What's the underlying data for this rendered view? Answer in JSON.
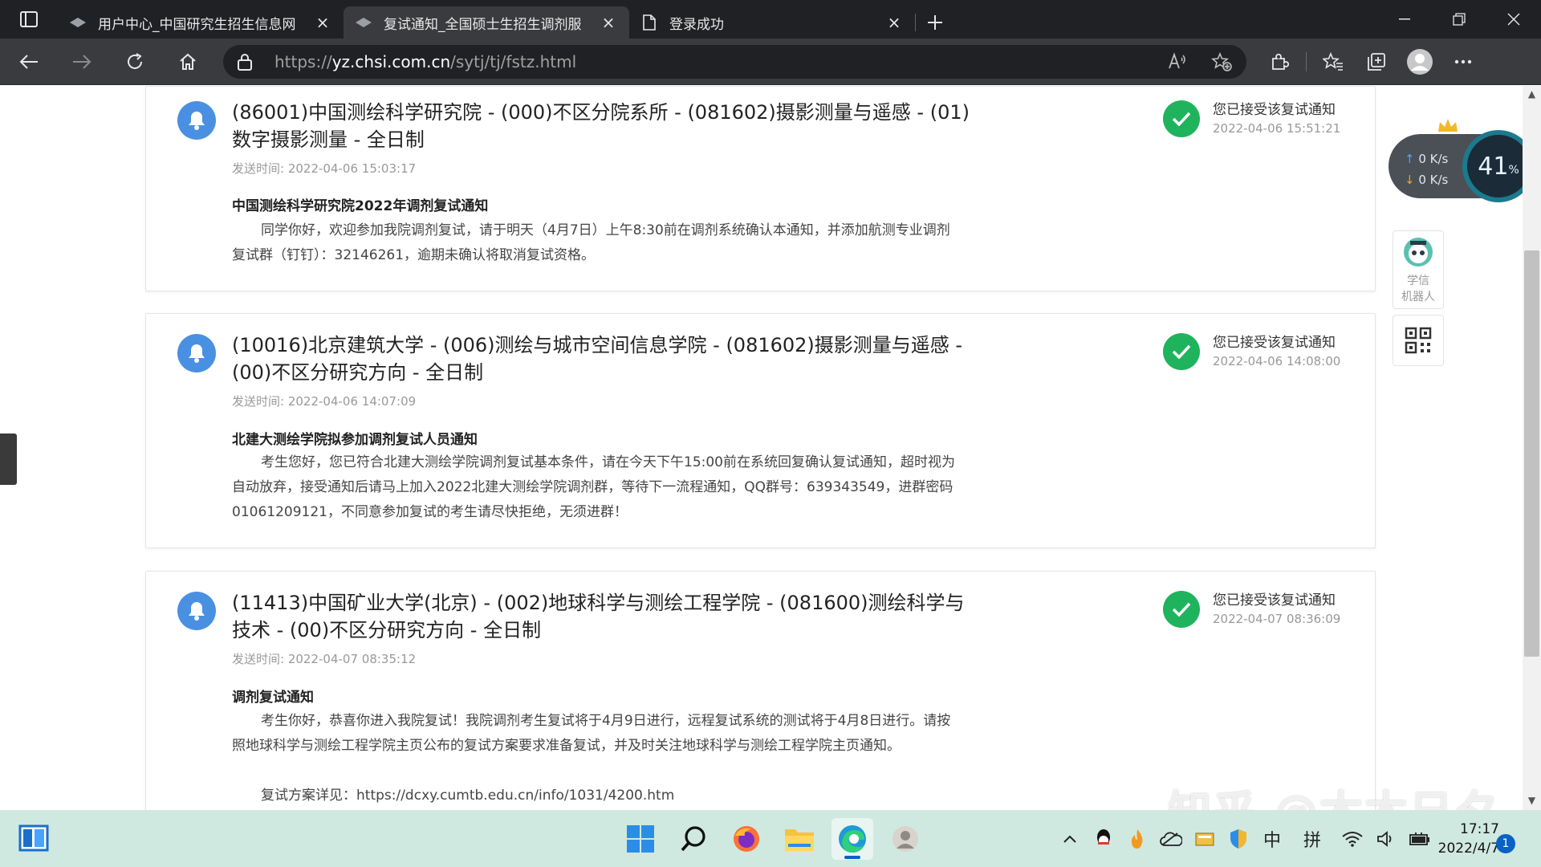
{
  "browser": {
    "tabs": [
      {
        "title": "用户中心_中国研究生招生信息网",
        "active": false
      },
      {
        "title": "复试通知_全国硕士生招生调剂服",
        "active": true
      },
      {
        "title": "登录成功",
        "active": false
      }
    ],
    "close_glyph": "×",
    "new_tab_glyph": "+",
    "url_prefix": "https://",
    "url_domain": "yz.chsi.com.cn",
    "url_path": "/sytj/tj/fstz.html"
  },
  "notices": [
    {
      "title": "(86001)中国测绘科学研究院 - (000)不区分院系所 - (081602)摄影测量与遥感 - (01)数字摄影测量 - 全日制",
      "sent_label": "发送时间:",
      "sent_time": "2022-04-06 15:03:17",
      "subject": "中国测绘科学研究院2022年调剂复试通知",
      "body": "同学你好，欢迎参加我院调剂复试，请于明天（4月7日）上午8:30前在调剂系统确认本通知，并添加航测专业调剂复试群（钉钉）：32146261，逾期未确认将取消复试资格。",
      "status": "您已接受该复试通知",
      "status_time": "2022-04-06 15:51:21"
    },
    {
      "title": "(10016)北京建筑大学 - (006)测绘与城市空间信息学院 - (081602)摄影测量与遥感 - (00)不区分研究方向 - 全日制",
      "sent_label": "发送时间:",
      "sent_time": "2022-04-06 14:07:09",
      "subject": "北建大测绘学院拟参加调剂复试人员通知",
      "body": "考生您好，您已符合北建大测绘学院调剂复试基本条件，请在今天下午15:00前在系统回复确认复试通知，超时视为自动放弃，接受通知后请马上加入2022北建大测绘学院调剂群，等待下一流程通知，QQ群号：639343549，进群密码01061209121，不同意参加复试的考生请尽快拒绝，无须进群！",
      "status": "您已接受该复试通知",
      "status_time": "2022-04-06 14:08:00"
    },
    {
      "title": "(11413)中国矿业大学(北京) - (002)地球科学与测绘工程学院 - (081600)测绘科学与技术 - (00)不区分研究方向 - 全日制",
      "sent_label": "发送时间:",
      "sent_time": "2022-04-07 08:35:12",
      "subject": "调剂复试通知",
      "body": "考生你好，恭喜你进入我院复试！我院调剂考生复试将于4月9日进行，远程复试系统的测试将于4月8日进行。请按照地球科学与测绘工程学院主页公布的复试方案要求准备复试，并及时关注地球科学与测绘工程学院主页通知。",
      "body2": "复试方案详见：https://dcxy.cumtb.edu.cn/info/1031/4200.htm",
      "status": "您已接受该复试通知",
      "status_time": "2022-04-07 08:36:09"
    }
  ],
  "widgets": {
    "speed_up": "0 K/s",
    "speed_down": "0 K/s",
    "speed_percent": "41",
    "percent_sign": "%",
    "robot_line1": "学信",
    "robot_line2": "机器人"
  },
  "watermark": "知乎 @木木日夕",
  "taskbar": {
    "ime_lang": "中",
    "ime_mode": "拼",
    "time": "17:17",
    "date": "2022/4/7",
    "notifications": "1"
  },
  "colors": {
    "accent_blue": "#4a90e2",
    "accept_green": "#1fb35d",
    "taskbar": "#cfe9e1"
  }
}
